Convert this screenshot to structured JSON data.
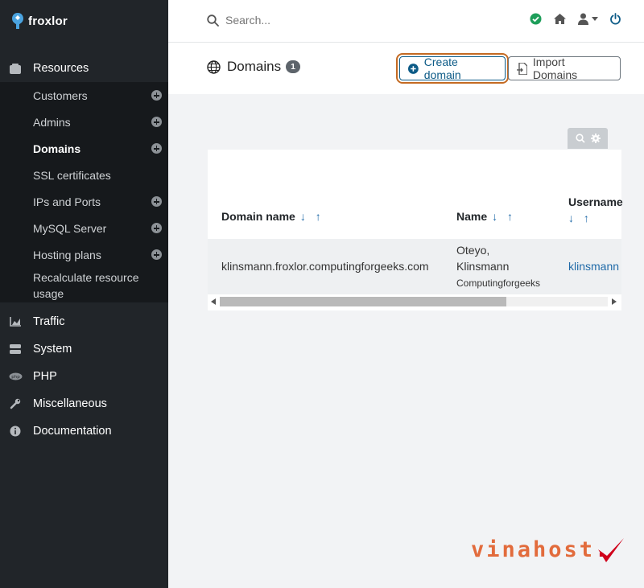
{
  "brand": {
    "name": "froxlor"
  },
  "sidebar": {
    "resources_label": "Resources",
    "items": [
      {
        "label": "Customers",
        "has_add": true
      },
      {
        "label": "Admins",
        "has_add": true
      },
      {
        "label": "Domains",
        "has_add": true,
        "active": true
      },
      {
        "label": "SSL certificates",
        "has_add": false
      },
      {
        "label": "IPs and Ports",
        "has_add": true
      },
      {
        "label": "MySQL Server",
        "has_add": true
      },
      {
        "label": "Hosting plans",
        "has_add": true
      },
      {
        "label": "Recalculate resource usage",
        "has_add": false
      }
    ],
    "sections": [
      {
        "label": "Traffic",
        "icon": "chart-icon"
      },
      {
        "label": "System",
        "icon": "server-icon"
      },
      {
        "label": "PHP",
        "icon": "php-icon"
      },
      {
        "label": "Miscellaneous",
        "icon": "wrench-icon"
      },
      {
        "label": "Documentation",
        "icon": "info-icon"
      }
    ]
  },
  "topbar": {
    "search_placeholder": "Search...",
    "status_color": "#1e9e5a"
  },
  "header": {
    "title": "Domains",
    "count": "1",
    "create_label": "Create domain",
    "import_label": "Import Domains"
  },
  "table": {
    "columns": [
      "Domain name",
      "Name",
      "Username"
    ],
    "sort_arrows": "↓ ↑",
    "rows": [
      {
        "domain": "klinsmann.froxlor.computingforgeeks.com",
        "name_line1": "Oteyo,",
        "name_line2": "Klinsmann",
        "company": "Computingforgeeks",
        "username": "klinsmann"
      }
    ]
  },
  "watermark": {
    "text": "vinahost",
    "dot": "."
  },
  "colors": {
    "sidebar": "#212529",
    "accent": "#0d5b87",
    "highlight": "#c46a22"
  }
}
